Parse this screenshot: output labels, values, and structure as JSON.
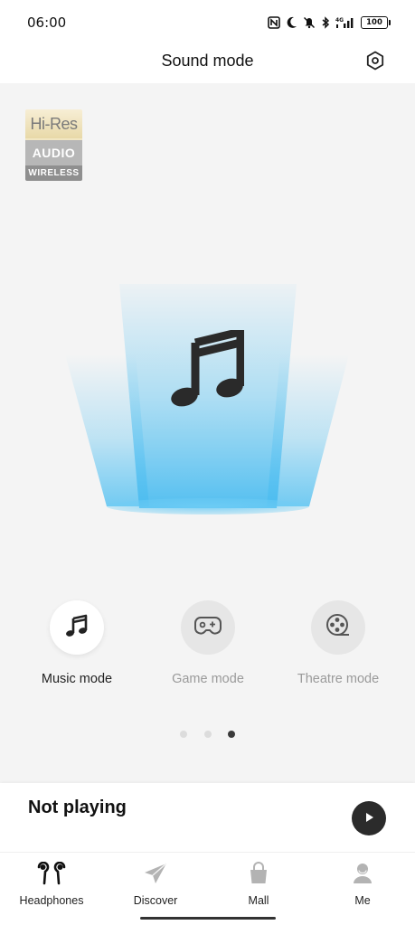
{
  "status_bar": {
    "time": "06:00",
    "battery": "100",
    "icons": [
      "nfc-icon",
      "moon-icon",
      "mute-icon",
      "bluetooth-icon",
      "signal-4g-icon",
      "battery-icon"
    ]
  },
  "header": {
    "title": "Sound mode",
    "settings_icon": "settings-hexagon-icon"
  },
  "badge": {
    "line1": "Hi-Res",
    "line2": "AUDIO",
    "line3": "WIRELESS"
  },
  "modes": [
    {
      "label": "Music mode",
      "icon": "music-note-icon",
      "active": true
    },
    {
      "label": "Game mode",
      "icon": "gamepad-icon",
      "active": false
    },
    {
      "label": "Theatre mode",
      "icon": "film-reel-icon",
      "active": false
    }
  ],
  "pager": {
    "count": 3,
    "active_index": 2
  },
  "player": {
    "status": "Not playing",
    "play_icon": "play-icon"
  },
  "bottom_nav": [
    {
      "label": "Headphones",
      "icon": "earbuds-icon",
      "active": true
    },
    {
      "label": "Discover",
      "icon": "paper-plane-icon",
      "active": false
    },
    {
      "label": "Mall",
      "icon": "shopping-bag-icon",
      "active": false
    },
    {
      "label": "Me",
      "icon": "person-icon",
      "active": false
    }
  ],
  "colors": {
    "accent_blue": "#5ac3f2",
    "icon_dark": "#2b2b2b",
    "inactive_gray": "#9a9a9a"
  }
}
